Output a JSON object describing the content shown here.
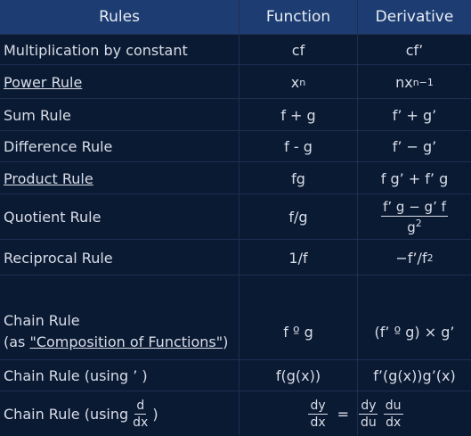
{
  "headers": {
    "rules": "Rules",
    "function": "Function",
    "derivative": "Derivative"
  },
  "rows": {
    "mult": {
      "rule": "Multiplication by constant",
      "fn": "cf",
      "der": "cf’"
    },
    "power": {
      "rule": "Power Rule",
      "fn_base": "x",
      "fn_exp": "n",
      "der_base": "nx",
      "der_exp": "n−1"
    },
    "sum": {
      "rule": "Sum Rule",
      "fn": "f + g",
      "der": "f’ + g’"
    },
    "diff": {
      "rule": "Difference Rule",
      "fn": "f - g",
      "der": "f’ − g’"
    },
    "product": {
      "rule": "Product Rule",
      "fn": "fg",
      "der": "f g’ + f’ g"
    },
    "quotient": {
      "rule": "Quotient Rule",
      "fn": "f/g",
      "der_num": "f’ g − g’ f",
      "der_den_base": "g",
      "der_den_exp": "2"
    },
    "reciprocal": {
      "rule": "Reciprocal Rule",
      "fn": "1/f",
      "der_base": "−f’/f",
      "der_exp": "2"
    },
    "chain": {
      "rule_line1": "Chain Rule",
      "rule_prefix": "(as ",
      "rule_link": "\"Composition of Functions\"",
      "rule_suffix": ")",
      "fn": "f º g",
      "der": "(f’ º g) × g’"
    },
    "chain_prime": {
      "rule": "Chain Rule (using ’ )",
      "fn": "f(g(x))",
      "der": "f’(g(x))g’(x)"
    },
    "chain_leibniz": {
      "rule_prefix": "Chain Rule (using",
      "rule_frac_num": "d",
      "rule_frac_den": "dx",
      "rule_suffix": ")",
      "lhs_num": "dy",
      "lhs_den": "dx",
      "eq": "=",
      "r1_num": "dy",
      "r1_den": "du",
      "r2_num": "du",
      "r2_den": "dx"
    }
  }
}
